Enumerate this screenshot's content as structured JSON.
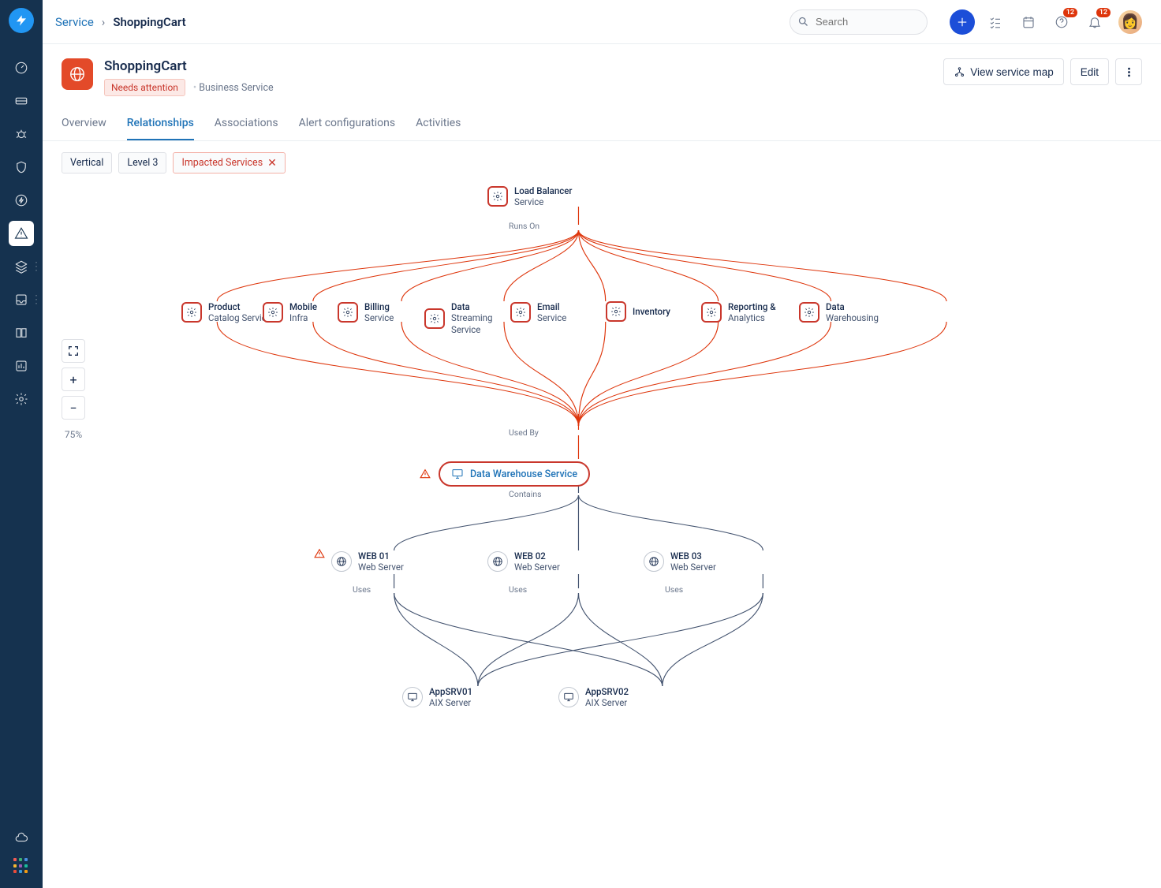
{
  "breadcrumb": {
    "parent": "Service",
    "current": "ShoppingCart"
  },
  "search": {
    "placeholder": "Search"
  },
  "topbar_badges": {
    "help": "12",
    "bell": "12"
  },
  "header": {
    "title": "ShoppingCart",
    "status_tag": "Needs attention",
    "type": "Business Service",
    "btn_map": "View service map",
    "btn_edit": "Edit"
  },
  "tabs": [
    "Overview",
    "Relationships",
    "Associations",
    "Alert configurations",
    "Activities"
  ],
  "active_tab": 1,
  "filters": {
    "orientation": "Vertical",
    "level": "Level 3",
    "impacted": "Impacted Services"
  },
  "zoom": "75%",
  "graph": {
    "root": {
      "line1": "Load Balancer",
      "line2": "Service"
    },
    "rel_runs": "Runs On",
    "mid_nodes": [
      {
        "line1": "Product",
        "line2": "Catalog",
        "line3": "Service"
      },
      {
        "line1": "Mobile",
        "line2": "Infra"
      },
      {
        "line1": "Billing",
        "line2": "Service"
      },
      {
        "line1": "Data",
        "line2": "Streaming",
        "line3": "Service"
      },
      {
        "line1": "Email",
        "line2": "Service"
      },
      {
        "line1": "Inventory"
      },
      {
        "line1": "Reporting &",
        "line2": "Analytics"
      },
      {
        "line1": "Data",
        "line2": "Warehousing"
      }
    ],
    "rel_used": "Used By",
    "central": "Data Warehouse Service",
    "rel_contains": "Contains",
    "webs": [
      {
        "line1": "WEB 01",
        "line2": "Web Server",
        "alert": true
      },
      {
        "line1": "WEB 02",
        "line2": "Web Server"
      },
      {
        "line1": "WEB 03",
        "line2": "Web Server"
      }
    ],
    "rel_uses": "Uses",
    "apps": [
      {
        "line1": "AppSRV01",
        "line2": "AIX Server"
      },
      {
        "line1": "AppSRV02",
        "line2": "AIX Server"
      }
    ]
  }
}
